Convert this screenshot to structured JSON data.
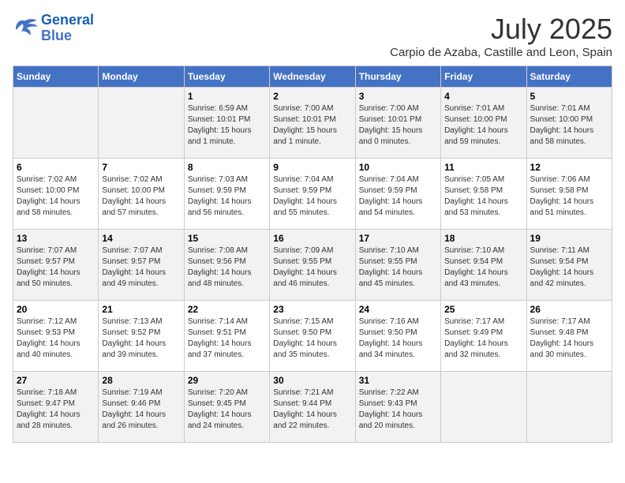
{
  "header": {
    "logo_line1": "General",
    "logo_line2": "Blue",
    "month": "July 2025",
    "location": "Carpio de Azaba, Castille and Leon, Spain"
  },
  "weekdays": [
    "Sunday",
    "Monday",
    "Tuesday",
    "Wednesday",
    "Thursday",
    "Friday",
    "Saturday"
  ],
  "weeks": [
    [
      {
        "day": "",
        "info": ""
      },
      {
        "day": "",
        "info": ""
      },
      {
        "day": "1",
        "info": "Sunrise: 6:59 AM\nSunset: 10:01 PM\nDaylight: 15 hours and 1 minute."
      },
      {
        "day": "2",
        "info": "Sunrise: 7:00 AM\nSunset: 10:01 PM\nDaylight: 15 hours and 1 minute."
      },
      {
        "day": "3",
        "info": "Sunrise: 7:00 AM\nSunset: 10:01 PM\nDaylight: 15 hours and 0 minutes."
      },
      {
        "day": "4",
        "info": "Sunrise: 7:01 AM\nSunset: 10:00 PM\nDaylight: 14 hours and 59 minutes."
      },
      {
        "day": "5",
        "info": "Sunrise: 7:01 AM\nSunset: 10:00 PM\nDaylight: 14 hours and 58 minutes."
      }
    ],
    [
      {
        "day": "6",
        "info": "Sunrise: 7:02 AM\nSunset: 10:00 PM\nDaylight: 14 hours and 58 minutes."
      },
      {
        "day": "7",
        "info": "Sunrise: 7:02 AM\nSunset: 10:00 PM\nDaylight: 14 hours and 57 minutes."
      },
      {
        "day": "8",
        "info": "Sunrise: 7:03 AM\nSunset: 9:59 PM\nDaylight: 14 hours and 56 minutes."
      },
      {
        "day": "9",
        "info": "Sunrise: 7:04 AM\nSunset: 9:59 PM\nDaylight: 14 hours and 55 minutes."
      },
      {
        "day": "10",
        "info": "Sunrise: 7:04 AM\nSunset: 9:59 PM\nDaylight: 14 hours and 54 minutes."
      },
      {
        "day": "11",
        "info": "Sunrise: 7:05 AM\nSunset: 9:58 PM\nDaylight: 14 hours and 53 minutes."
      },
      {
        "day": "12",
        "info": "Sunrise: 7:06 AM\nSunset: 9:58 PM\nDaylight: 14 hours and 51 minutes."
      }
    ],
    [
      {
        "day": "13",
        "info": "Sunrise: 7:07 AM\nSunset: 9:57 PM\nDaylight: 14 hours and 50 minutes."
      },
      {
        "day": "14",
        "info": "Sunrise: 7:07 AM\nSunset: 9:57 PM\nDaylight: 14 hours and 49 minutes."
      },
      {
        "day": "15",
        "info": "Sunrise: 7:08 AM\nSunset: 9:56 PM\nDaylight: 14 hours and 48 minutes."
      },
      {
        "day": "16",
        "info": "Sunrise: 7:09 AM\nSunset: 9:55 PM\nDaylight: 14 hours and 46 minutes."
      },
      {
        "day": "17",
        "info": "Sunrise: 7:10 AM\nSunset: 9:55 PM\nDaylight: 14 hours and 45 minutes."
      },
      {
        "day": "18",
        "info": "Sunrise: 7:10 AM\nSunset: 9:54 PM\nDaylight: 14 hours and 43 minutes."
      },
      {
        "day": "19",
        "info": "Sunrise: 7:11 AM\nSunset: 9:54 PM\nDaylight: 14 hours and 42 minutes."
      }
    ],
    [
      {
        "day": "20",
        "info": "Sunrise: 7:12 AM\nSunset: 9:53 PM\nDaylight: 14 hours and 40 minutes."
      },
      {
        "day": "21",
        "info": "Sunrise: 7:13 AM\nSunset: 9:52 PM\nDaylight: 14 hours and 39 minutes."
      },
      {
        "day": "22",
        "info": "Sunrise: 7:14 AM\nSunset: 9:51 PM\nDaylight: 14 hours and 37 minutes."
      },
      {
        "day": "23",
        "info": "Sunrise: 7:15 AM\nSunset: 9:50 PM\nDaylight: 14 hours and 35 minutes."
      },
      {
        "day": "24",
        "info": "Sunrise: 7:16 AM\nSunset: 9:50 PM\nDaylight: 14 hours and 34 minutes."
      },
      {
        "day": "25",
        "info": "Sunrise: 7:17 AM\nSunset: 9:49 PM\nDaylight: 14 hours and 32 minutes."
      },
      {
        "day": "26",
        "info": "Sunrise: 7:17 AM\nSunset: 9:48 PM\nDaylight: 14 hours and 30 minutes."
      }
    ],
    [
      {
        "day": "27",
        "info": "Sunrise: 7:18 AM\nSunset: 9:47 PM\nDaylight: 14 hours and 28 minutes."
      },
      {
        "day": "28",
        "info": "Sunrise: 7:19 AM\nSunset: 9:46 PM\nDaylight: 14 hours and 26 minutes."
      },
      {
        "day": "29",
        "info": "Sunrise: 7:20 AM\nSunset: 9:45 PM\nDaylight: 14 hours and 24 minutes."
      },
      {
        "day": "30",
        "info": "Sunrise: 7:21 AM\nSunset: 9:44 PM\nDaylight: 14 hours and 22 minutes."
      },
      {
        "day": "31",
        "info": "Sunrise: 7:22 AM\nSunset: 9:43 PM\nDaylight: 14 hours and 20 minutes."
      },
      {
        "day": "",
        "info": ""
      },
      {
        "day": "",
        "info": ""
      }
    ]
  ]
}
